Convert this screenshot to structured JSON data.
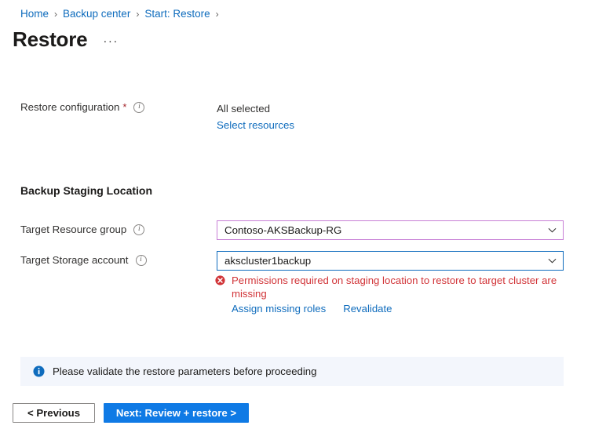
{
  "breadcrumb": {
    "items": [
      {
        "label": "Home"
      },
      {
        "label": "Backup center"
      },
      {
        "label": "Start: Restore"
      }
    ],
    "separator": "›"
  },
  "header": {
    "title": "Restore",
    "more_label": "···"
  },
  "restore_configuration": {
    "label": "Restore configuration",
    "required_marker": "*",
    "info_glyph": "i",
    "value": "All selected",
    "link_label": "Select resources"
  },
  "staging": {
    "section_title": "Backup Staging Location",
    "resource_group": {
      "label": "Target Resource group",
      "info_glyph": "i",
      "value": "Contoso-AKSBackup-RG",
      "border_color": "#c77fd6"
    },
    "storage_account": {
      "label": "Target Storage account",
      "info_glyph": "i",
      "value": "akscluster1backup",
      "border_color": "#0f6cbd"
    },
    "error": {
      "icon_name": "error-circle-icon",
      "message": "Permissions required on staging location to restore to target cluster are missing",
      "color": "#d13438",
      "links": [
        {
          "label": "Assign missing roles"
        },
        {
          "label": "Revalidate"
        }
      ]
    }
  },
  "info_banner": {
    "icon_name": "info-circle-icon",
    "text": "Please validate the restore parameters before proceeding",
    "background": "#f3f6fc",
    "icon_color": "#0f6cbd"
  },
  "footer": {
    "previous_label": "< Previous",
    "next_label": "Next: Review + restore >",
    "primary_color": "#0f7ae5"
  }
}
